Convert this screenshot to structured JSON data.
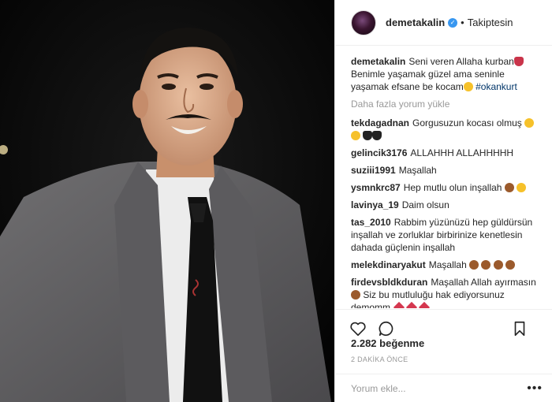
{
  "post": {
    "username": "demetakalin",
    "follow_status": "Takiptesin",
    "dot": "•",
    "caption_user": "demetakalin",
    "caption_text": "Seni veren Allaha kurban",
    "caption_text2": " Benimle yaşamak güzel ama seninle yaşamak efsane be kocam",
    "caption_tag": "#okankurt",
    "load_more": "Daha fazla yorum yükle",
    "likes": "2.282 beğenme",
    "time": "2 DAKİKA ÖNCE",
    "comment_placeholder": "Yorum ekle...",
    "options": "•••"
  },
  "comments": [
    {
      "user": "tekdagadnan",
      "text": "Gorgusuzun kocası olmuş"
    },
    {
      "user": "gelincik3176",
      "text": "ALLAHHH ALLAHHHHH"
    },
    {
      "user": "suziii1991",
      "text": "Maşallah"
    },
    {
      "user": "ysmnkrc87",
      "text": "Hep mutlu olun inşallah"
    },
    {
      "user": "lavinya_19",
      "text": "Daim olsun"
    },
    {
      "user": "tas_2010",
      "text": "Rabbim yüzünüzü hep güldürsün inşallah ve zorluklar birbirinize kenetlesin dahada güçlenin inşallah"
    },
    {
      "user": "melekdinaryakut",
      "text": "Maşallah"
    },
    {
      "user": "firdevsbldkduran",
      "text": "Maşallah Allah ayırmasın"
    },
    {
      "text": " Siz bu mutluluğu hak ediyorsunuz demomm"
    }
  ],
  "icons": [
    "verified-icon",
    "like-icon",
    "comment-icon",
    "save-icon",
    "options-icon"
  ],
  "colors": {
    "link": "#003569",
    "verified": "#3897f0",
    "muted": "#999999"
  }
}
